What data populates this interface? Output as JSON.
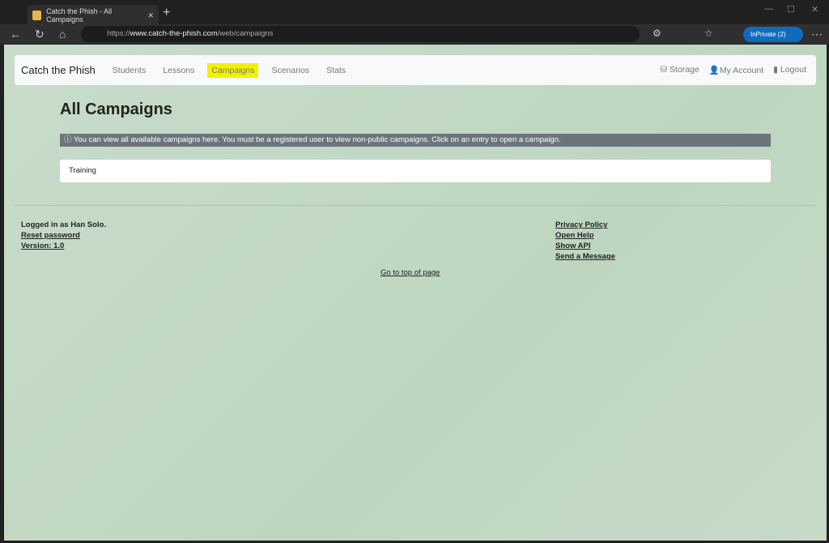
{
  "browser": {
    "tab_title": "Catch the Phish - All Campaigns",
    "url_prefix": "https://",
    "url_host": "www.catch-the-phish.com",
    "url_path": "/web/campaigns",
    "inprivate": "InPrivate (2)"
  },
  "navbar": {
    "brand": "Catch the Phish",
    "items": [
      "Students",
      "Lessons",
      "Campaigns",
      "Scenarios",
      "Stats"
    ],
    "highlighted": "Campaigns",
    "highlight_color": "#f2f200",
    "right": [
      "Storage",
      "My Account",
      "Logout"
    ]
  },
  "main": {
    "title": "All Campaigns",
    "info": "You can view all available campaigns here. You must be a registered user to view non-public campaigns. Click on an entry to open a campaign.",
    "campaigns": [
      "Training"
    ]
  },
  "footer": {
    "logged_in": "Logged in as Han Solo.",
    "reset": "Reset password",
    "version": "Version: 1.0",
    "links": [
      "Privacy Policy",
      "Open Help",
      "Show API",
      "Send a Message"
    ],
    "top": "Go to top of page"
  }
}
